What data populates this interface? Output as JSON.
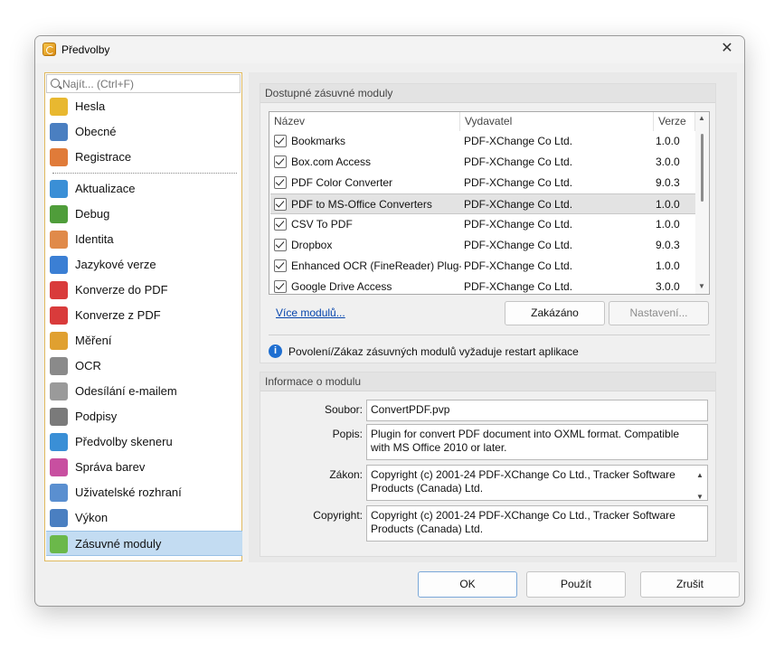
{
  "window": {
    "title": "Předvolby",
    "close_glyph": "✕"
  },
  "search": {
    "placeholder": "Najít... (Ctrl+F)"
  },
  "sidebar": {
    "items": [
      {
        "label": "Hesla",
        "icon": "key-icon",
        "color": "#e8b830"
      },
      {
        "label": "Obecné",
        "icon": "general-settings-icon",
        "color": "#4a7fc1"
      },
      {
        "label": "Registrace",
        "icon": "user-add-icon",
        "color": "#e07b39"
      },
      {
        "label": "Aktualizace",
        "icon": "globe-update-icon",
        "color": "#3a8fd6"
      },
      {
        "label": "Debug",
        "icon": "bug-icon",
        "color": "#4f9d3a"
      },
      {
        "label": "Identita",
        "icon": "person-icon",
        "color": "#e08a4a"
      },
      {
        "label": "Jazykové verze",
        "icon": "translate-icon",
        "color": "#3b7fd4"
      },
      {
        "label": "Konverze do PDF",
        "icon": "pdf-convert-to-icon",
        "color": "#d93b3b"
      },
      {
        "label": "Konverze z PDF",
        "icon": "pdf-convert-from-icon",
        "color": "#d93b3b"
      },
      {
        "label": "Měření",
        "icon": "ruler-icon",
        "color": "#e0a030"
      },
      {
        "label": "OCR",
        "icon": "ocr-icon",
        "color": "#8a8a8a"
      },
      {
        "label": "Odesílání e-mailem",
        "icon": "envelope-icon",
        "color": "#9a9a9a"
      },
      {
        "label": "Podpisy",
        "icon": "signature-icon",
        "color": "#7a7a7a"
      },
      {
        "label": "Předvolby skeneru",
        "icon": "scanner-icon",
        "color": "#3a8fd6"
      },
      {
        "label": "Správa barev",
        "icon": "color-wheel-icon",
        "color": "#c84fa0"
      },
      {
        "label": "Uživatelské rozhraní",
        "icon": "ui-icon",
        "color": "#5a8fd0"
      },
      {
        "label": "Výkon",
        "icon": "gauge-icon",
        "color": "#4a7fc1"
      },
      {
        "label": "Zásuvné moduly",
        "icon": "puzzle-icon",
        "color": "#6bb84a"
      }
    ],
    "selected_index": 17
  },
  "plugins_group": {
    "title": "Dostupné zásuvné moduly",
    "columns": [
      "Název",
      "Vydavatel",
      "Verze"
    ],
    "rows": [
      {
        "name": "Bookmarks",
        "publisher": "PDF-XChange Co Ltd.",
        "version": "1.0.0",
        "checked": true
      },
      {
        "name": "Box.com Access",
        "publisher": "PDF-XChange Co Ltd.",
        "version": "3.0.0",
        "checked": true
      },
      {
        "name": "PDF Color Converter",
        "publisher": "PDF-XChange Co Ltd.",
        "version": "9.0.3",
        "checked": true
      },
      {
        "name": "PDF to MS-Office Converters",
        "publisher": "PDF-XChange Co Ltd.",
        "version": "1.0.0",
        "checked": true
      },
      {
        "name": "CSV To PDF",
        "publisher": "PDF-XChange Co Ltd.",
        "version": "1.0.0",
        "checked": true
      },
      {
        "name": "Dropbox",
        "publisher": "PDF-XChange Co Ltd.",
        "version": "9.0.3",
        "checked": true
      },
      {
        "name": "Enhanced OCR (FineReader) Plug-In",
        "publisher": "PDF-XChange Co Ltd.",
        "version": "1.0.0",
        "checked": true
      },
      {
        "name": "Google Drive Access",
        "publisher": "PDF-XChange Co Ltd.",
        "version": "3.0.0",
        "checked": true
      }
    ],
    "selected_row": 3,
    "more_link": "Více modulů...",
    "toggle_button": "Zakázáno",
    "settings_button": "Nastavení...",
    "info_text": "Povolení/Zákaz zásuvných modulů vyžaduje restart aplikace"
  },
  "module_info": {
    "title": "Informace o modulu",
    "file_label": "Soubor:",
    "file_value": "ConvertPDF.pvp",
    "description_label": "Popis:",
    "description_value": "Plugin for convert PDF document into OXML format. Compatible with MS Office 2010 or later.",
    "law_label": "Zákon:",
    "law_value": "Copyright (c) 2001-24 PDF-XChange Co Ltd., Tracker Software Products (Canada) Ltd.",
    "copyright_label": "Copyright:",
    "copyright_value": "Copyright (c) 2001-24 PDF-XChange Co Ltd., Tracker Software Products (Canada) Ltd."
  },
  "footer": {
    "ok": "OK",
    "apply": "Použít",
    "cancel": "Zrušit"
  }
}
